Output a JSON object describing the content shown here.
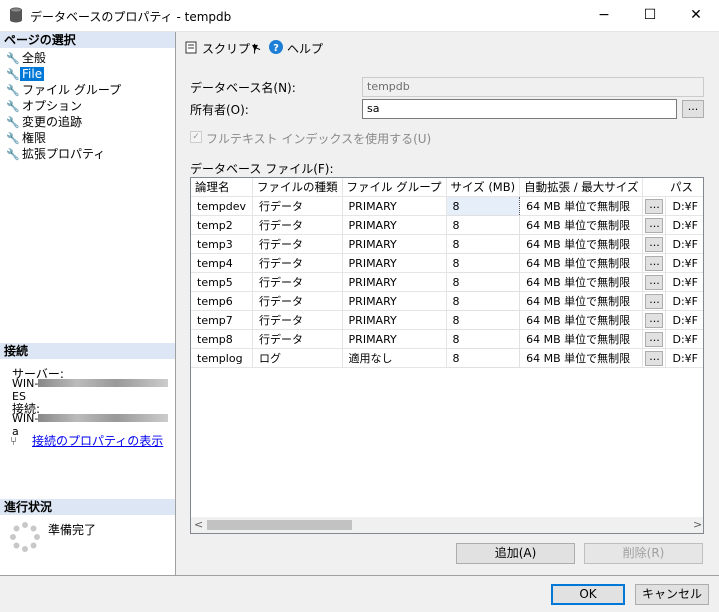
{
  "window": {
    "title": "データベースのプロパティ - tempdb",
    "minimize": "−",
    "maximize": "☐",
    "close": "✕"
  },
  "left": {
    "select_page_header": "ページの選択",
    "pages": [
      {
        "label": "全般"
      },
      {
        "label": "File"
      },
      {
        "label": "ファイル グループ"
      },
      {
        "label": "オプション"
      },
      {
        "label": "変更の追跡"
      },
      {
        "label": "権限"
      },
      {
        "label": "拡張プロパティ"
      }
    ],
    "connection_header": "接続",
    "server_label": "サーバー:",
    "server_value": "WIN-",
    "server_suffix": "ES",
    "connection_label": "接続:",
    "connection_value": "WIN-",
    "connection_suffix": "a",
    "view_link": "接続のプロパティの表示",
    "progress_header": "進行状況",
    "progress_status": "準備完了"
  },
  "toolbar": {
    "script": "スクリプト",
    "script_arrow": "▾",
    "help": "ヘルプ"
  },
  "form": {
    "db_name_label": "データベース名(N):",
    "db_name_value": "tempdb",
    "owner_label": "所有者(O):",
    "owner_value": "sa",
    "browse": "...",
    "fulltext_label": "フルテキスト インデックスを使用する(U)",
    "files_label": "データベース ファイル(F):"
  },
  "grid": {
    "columns": [
      "論理名",
      "ファイルの種類",
      "ファイル グループ",
      "サイズ (MB)",
      "自動拡張 / 最大サイズ",
      "",
      "パス"
    ],
    "rows": [
      {
        "name": "tempdev",
        "type": "行データ",
        "group": "PRIMARY",
        "size": "8",
        "growth": "64 MB 単位で無制限",
        "btn": "...",
        "path": "D:¥F"
      },
      {
        "name": "temp2",
        "type": "行データ",
        "group": "PRIMARY",
        "size": "8",
        "growth": "64 MB 単位で無制限",
        "btn": "...",
        "path": "D:¥F"
      },
      {
        "name": "temp3",
        "type": "行データ",
        "group": "PRIMARY",
        "size": "8",
        "growth": "64 MB 単位で無制限",
        "btn": "...",
        "path": "D:¥F"
      },
      {
        "name": "temp4",
        "type": "行データ",
        "group": "PRIMARY",
        "size": "8",
        "growth": "64 MB 単位で無制限",
        "btn": "...",
        "path": "D:¥F"
      },
      {
        "name": "temp5",
        "type": "行データ",
        "group": "PRIMARY",
        "size": "8",
        "growth": "64 MB 単位で無制限",
        "btn": "...",
        "path": "D:¥F"
      },
      {
        "name": "temp6",
        "type": "行データ",
        "group": "PRIMARY",
        "size": "8",
        "growth": "64 MB 単位で無制限",
        "btn": "...",
        "path": "D:¥F"
      },
      {
        "name": "temp7",
        "type": "行データ",
        "group": "PRIMARY",
        "size": "8",
        "growth": "64 MB 単位で無制限",
        "btn": "...",
        "path": "D:¥F"
      },
      {
        "name": "temp8",
        "type": "行データ",
        "group": "PRIMARY",
        "size": "8",
        "growth": "64 MB 単位で無制限",
        "btn": "...",
        "path": "D:¥F"
      },
      {
        "name": "templog",
        "type": "ログ",
        "group": "適用なし",
        "size": "8",
        "growth": "64 MB 単位で無制限",
        "btn": "...",
        "path": "D:¥F"
      }
    ],
    "scroll_left": "<",
    "scroll_right": ">"
  },
  "buttons": {
    "add": "追加(A)",
    "remove": "削除(R)",
    "ok": "OK",
    "cancel": "キャンセル"
  },
  "colors": {
    "selection": "#0078d7",
    "section_header": "#dce6f4",
    "link": "#0000ee"
  },
  "icons": {
    "db": "database-icon",
    "wrench": "wrench-icon",
    "script": "script-icon",
    "help": "help-icon",
    "connection": "connection-icon",
    "spinner": "spinner-icon"
  }
}
